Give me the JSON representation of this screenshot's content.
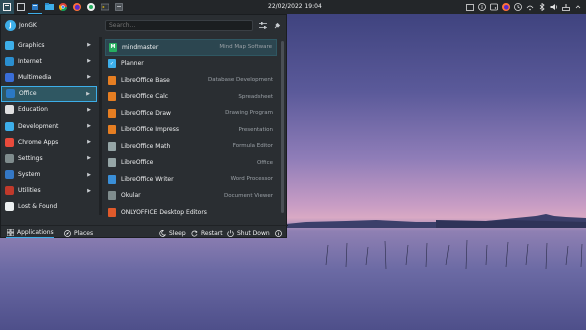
{
  "panel": {
    "clock": "22/02/2022  19:04",
    "launcher_icons": [
      "window-icon",
      "stack-icon",
      "files-icon",
      "chrome-icon",
      "firefox-icon",
      "media-icon",
      "terminal-icon",
      "notes-icon"
    ],
    "tray_icons": [
      "window-list-icon",
      "info-icon",
      "disk-icon",
      "firefox-tray-icon",
      "clock-tray-icon",
      "wifi-icon",
      "bluetooth-icon",
      "volume-icon",
      "network-icon",
      "expand-icon"
    ]
  },
  "launcher": {
    "username": "JonGK",
    "avatar_letter": "J",
    "search_placeholder": "Search...",
    "categories": [
      {
        "label": "Graphics",
        "color": "#3daee9",
        "selected": false
      },
      {
        "label": "Internet",
        "color": "#2a8fd0",
        "selected": false
      },
      {
        "label": "Multimedia",
        "color": "#3a6ed8",
        "selected": false
      },
      {
        "label": "Office",
        "color": "#2b79c4",
        "selected": true
      },
      {
        "label": "Education",
        "color": "#e0e0e0",
        "selected": false
      },
      {
        "label": "Development",
        "color": "#3daee9",
        "selected": false
      },
      {
        "label": "Chrome Apps",
        "color": "#e94b3c",
        "selected": false
      },
      {
        "label": "Settings",
        "color": "#7f8c8d",
        "selected": false
      },
      {
        "label": "System",
        "color": "#3478c6",
        "selected": false
      },
      {
        "label": "Utilities",
        "color": "#c0392b",
        "selected": false
      },
      {
        "label": "Lost & Found",
        "color": "#ecf0f1",
        "selected": false
      }
    ],
    "apps": [
      {
        "name": "mindmaster",
        "desc": "Mind Map Software",
        "color": "#27ae60",
        "glyph": "M",
        "highlight": true
      },
      {
        "name": "Planner",
        "desc": "",
        "color": "#3daee9",
        "glyph": "✓",
        "highlight": false
      },
      {
        "name": "LibreOffice Base",
        "desc": "Database Development",
        "color": "#e67e22",
        "glyph": "",
        "highlight": false
      },
      {
        "name": "LibreOffice Calc",
        "desc": "Spreadsheet",
        "color": "#e67e22",
        "glyph": "",
        "highlight": false
      },
      {
        "name": "LibreOffice Draw",
        "desc": "Drawing Program",
        "color": "#e67e22",
        "glyph": "",
        "highlight": false
      },
      {
        "name": "LibreOffice Impress",
        "desc": "Presentation",
        "color": "#e67e22",
        "glyph": "",
        "highlight": false
      },
      {
        "name": "LibreOffice Math",
        "desc": "Formula Editor",
        "color": "#95a5a6",
        "glyph": "",
        "highlight": false
      },
      {
        "name": "LibreOffice",
        "desc": "Office",
        "color": "#95a5a6",
        "glyph": "",
        "highlight": false
      },
      {
        "name": "LibreOffice Writer",
        "desc": "Word Processor",
        "color": "#3a8fd8",
        "glyph": "",
        "highlight": false
      },
      {
        "name": "Okular",
        "desc": "Document Viewer",
        "color": "#7f8c8d",
        "glyph": "",
        "highlight": false
      },
      {
        "name": "ONLYOFFICE Desktop Editors",
        "desc": "",
        "color": "#e05a2b",
        "glyph": "",
        "highlight": false
      }
    ],
    "footer": {
      "applications": "Applications",
      "places": "Places",
      "sleep": "Sleep",
      "restart": "Restart",
      "shutdown": "Shut Down"
    }
  }
}
